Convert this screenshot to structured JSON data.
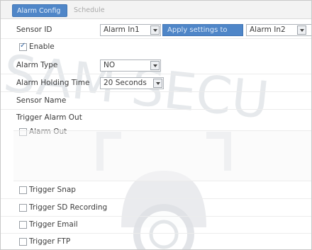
{
  "tabs": [
    {
      "label": "Alarm Config",
      "active": true
    },
    {
      "label": "Schedule",
      "active": false
    }
  ],
  "sensor_id": {
    "label": "Sensor ID",
    "value": "Alarm In1",
    "apply_label": "Apply settings to",
    "apply_target": "Alarm In2"
  },
  "enable": {
    "label": "Enable",
    "checked": true
  },
  "alarm_type": {
    "label": "Alarm Type",
    "value": "NO"
  },
  "holding_time": {
    "label": "Alarm Holding Time",
    "value": "20 Seconds"
  },
  "sensor_name": {
    "label": "Sensor Name"
  },
  "trigger_alarm_out": {
    "label": "Trigger Alarm Out"
  },
  "alarm_out": {
    "label": "Alarm Out",
    "checked": false
  },
  "triggers": [
    {
      "label": "Trigger Snap",
      "checked": false
    },
    {
      "label": "Trigger SD Recording",
      "checked": false
    },
    {
      "label": "Trigger Email",
      "checked": false
    },
    {
      "label": "Trigger FTP",
      "checked": false
    }
  ],
  "watermark": {
    "text": "SAM SECU"
  },
  "colors": {
    "accent": "#4f86c8",
    "border": "#aeb3b9"
  }
}
